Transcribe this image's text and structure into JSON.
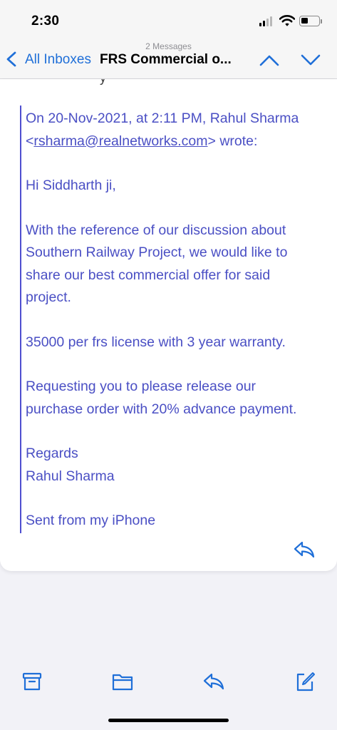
{
  "status_bar": {
    "time": "2:30",
    "icons": [
      "cellular-signal-icon",
      "wifi-icon",
      "battery-icon"
    ]
  },
  "nav": {
    "message_count": "2 Messages",
    "back_label": "All Inboxes",
    "title": "FRS Commercial o...",
    "icons": [
      "chevron-left-icon",
      "chevron-up-icon",
      "chevron-down-icon"
    ]
  },
  "message": {
    "peek_text": "y",
    "quote_header_prefix": "On 20-Nov-2021, at 2:11 PM, Rahul Sharma",
    "quote_email_open": "<",
    "quote_email": "rsharma@realnetworks.com",
    "quote_email_close": "> wrote:",
    "greeting": "Hi Siddharth ji,",
    "body_line_1": "With the reference of our discussion about",
    "body_line_2": "Southern Railway Project, we would like to",
    "body_line_3": "share our best commercial offer for said",
    "body_line_4": "project.",
    "offer": "35000 per frs license with 3 year warranty.",
    "request_line_1": "Requesting you to please release our",
    "request_line_2": "purchase order with 20% advance payment.",
    "signoff": "Regards",
    "signature": "Rahul Sharma",
    "sent_from": "Sent from my iPhone"
  },
  "toolbar": {
    "icons": [
      "archive-icon",
      "folder-icon",
      "reply-icon",
      "compose-icon"
    ]
  },
  "colors": {
    "accent": "#1f6fd8",
    "quote_text": "#4a4fc4",
    "quote_bar": "#4f4fd0",
    "background": "#f2f2f7"
  }
}
